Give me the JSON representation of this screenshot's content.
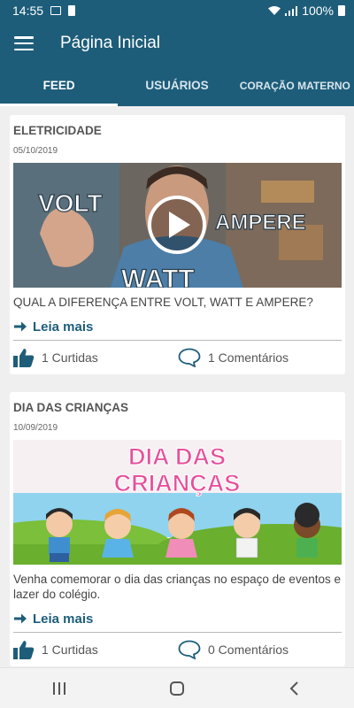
{
  "status_bar": {
    "time": "14:55",
    "battery": "100%"
  },
  "app_bar": {
    "title": "Página Inicial"
  },
  "tabs": [
    {
      "label": "FEED",
      "active": true
    },
    {
      "label": "USUÁRIOS",
      "active": false
    },
    {
      "label": "CORAÇÃO MATERNO",
      "active": false
    }
  ],
  "posts": [
    {
      "title": "ELETRICIDADE",
      "date": "05/10/2019",
      "image_text": {
        "volt": "VOLT",
        "ampere": "AMPERE",
        "watt": "WATT"
      },
      "text": "QUAL A DIFERENÇA ENTRE VOLT, WATT E AMPERE?",
      "read_more": "Leia mais",
      "likes": "1 Curtidas",
      "comments": "1 Comentários"
    },
    {
      "title": "DIA DAS CRIANÇAS",
      "date": "10/09/2019",
      "image_text": {
        "line1": "DIA DAS",
        "line2": "CRIANÇAS"
      },
      "text": "Venha comemorar o dia das crianças no espaço de eventos e lazer do colégio.",
      "read_more": "Leia mais",
      "likes": "1 Curtidas",
      "comments": "0 Comentários"
    }
  ],
  "colors": {
    "primary": "#1d5d7a",
    "background": "#efefef",
    "card": "#ffffff"
  },
  "icons": {
    "menu": "hamburger-icon",
    "play": "play-icon",
    "read_more": "arrow-right-icon",
    "like": "thumbs-up-icon",
    "comment": "speech-bubble-icon",
    "nav": [
      "recent-apps-icon",
      "home-icon",
      "back-icon"
    ]
  }
}
